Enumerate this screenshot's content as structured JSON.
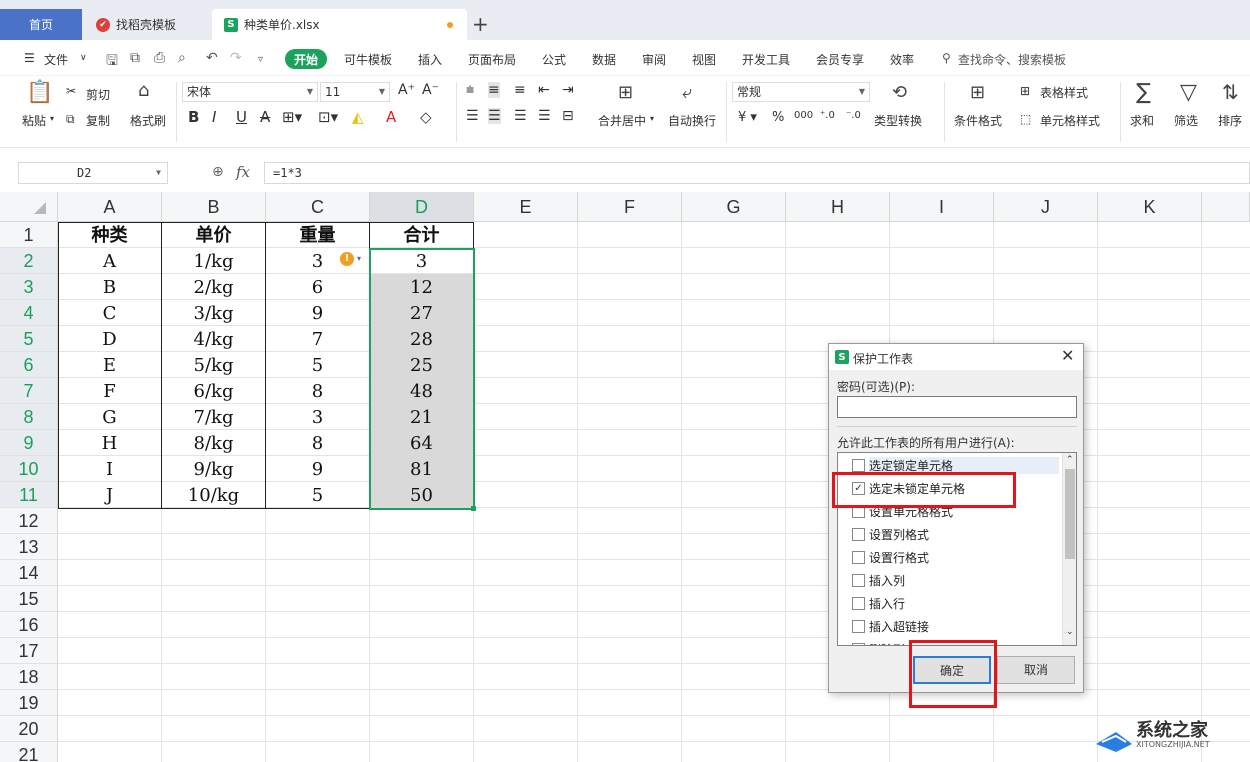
{
  "tabs": [
    {
      "label": "首页"
    },
    {
      "label": "找稻壳模板"
    },
    {
      "label": "种类单价.xlsx"
    }
  ],
  "menu": {
    "file": "文件",
    "items": [
      "开始",
      "可牛模板",
      "插入",
      "页面布局",
      "公式",
      "数据",
      "审阅",
      "视图",
      "开发工具",
      "会员专享",
      "效率"
    ],
    "search_placeholder": "查找命令、搜索模板"
  },
  "ribbon": {
    "paste": "粘贴",
    "cut": "剪切",
    "copy": "复制",
    "format_painter": "格式刷",
    "font_name": "宋体",
    "font_size": "11",
    "merge_center": "合并居中",
    "wrap_text": "自动换行",
    "number_format": "常规",
    "type_convert": "类型转换",
    "cond_format": "条件格式",
    "table_style": "表格样式",
    "cell_style": "单元格样式",
    "sum": "求和",
    "filter": "筛选",
    "sort": "排序"
  },
  "formula_bar": {
    "name_box": "D2",
    "fx": "fx",
    "formula": "=1*3"
  },
  "grid": {
    "columns": [
      "A",
      "B",
      "C",
      "D",
      "E",
      "F",
      "G",
      "H",
      "I",
      "J",
      "K"
    ],
    "rows": [
      "1",
      "2",
      "3",
      "4",
      "5",
      "6",
      "7",
      "8",
      "9",
      "10",
      "11",
      "12",
      "13",
      "14",
      "15",
      "16",
      "17",
      "18",
      "19",
      "20",
      "21"
    ],
    "header": [
      "种类",
      "单价",
      "重量",
      "合计"
    ],
    "data": [
      [
        "A",
        "1/kg",
        "3",
        "3"
      ],
      [
        "B",
        "2/kg",
        "6",
        "12"
      ],
      [
        "C",
        "3/kg",
        "9",
        "27"
      ],
      [
        "D",
        "4/kg",
        "7",
        "28"
      ],
      [
        "E",
        "5/kg",
        "5",
        "25"
      ],
      [
        "F",
        "6/kg",
        "8",
        "48"
      ],
      [
        "G",
        "7/kg",
        "3",
        "21"
      ],
      [
        "H",
        "8/kg",
        "8",
        "64"
      ],
      [
        "I",
        "9/kg",
        "9",
        "81"
      ],
      [
        "J",
        "10/kg",
        "5",
        "50"
      ]
    ]
  },
  "dialog": {
    "title": "保护工作表",
    "password_label": "密码(可选)(P):",
    "password_value": "",
    "allow_label": "允许此工作表的所有用户进行(A):",
    "options": [
      {
        "label": "选定锁定单元格",
        "checked": false
      },
      {
        "label": "选定未锁定单元格",
        "checked": true
      },
      {
        "label": "设置单元格格式",
        "checked": false
      },
      {
        "label": "设置列格式",
        "checked": false
      },
      {
        "label": "设置行格式",
        "checked": false
      },
      {
        "label": "插入列",
        "checked": false
      },
      {
        "label": "插入行",
        "checked": false
      },
      {
        "label": "插入超链接",
        "checked": false
      },
      {
        "label": "删除列",
        "checked": false
      }
    ],
    "ok": "确定",
    "cancel": "取消"
  },
  "watermark": {
    "name": "系统之家",
    "url": "XITONGZHIJIA.NET"
  },
  "colors": {
    "accent_green": "#1ca25d",
    "home_tab": "#4a73c7",
    "highlight_red": "#e0161b"
  }
}
